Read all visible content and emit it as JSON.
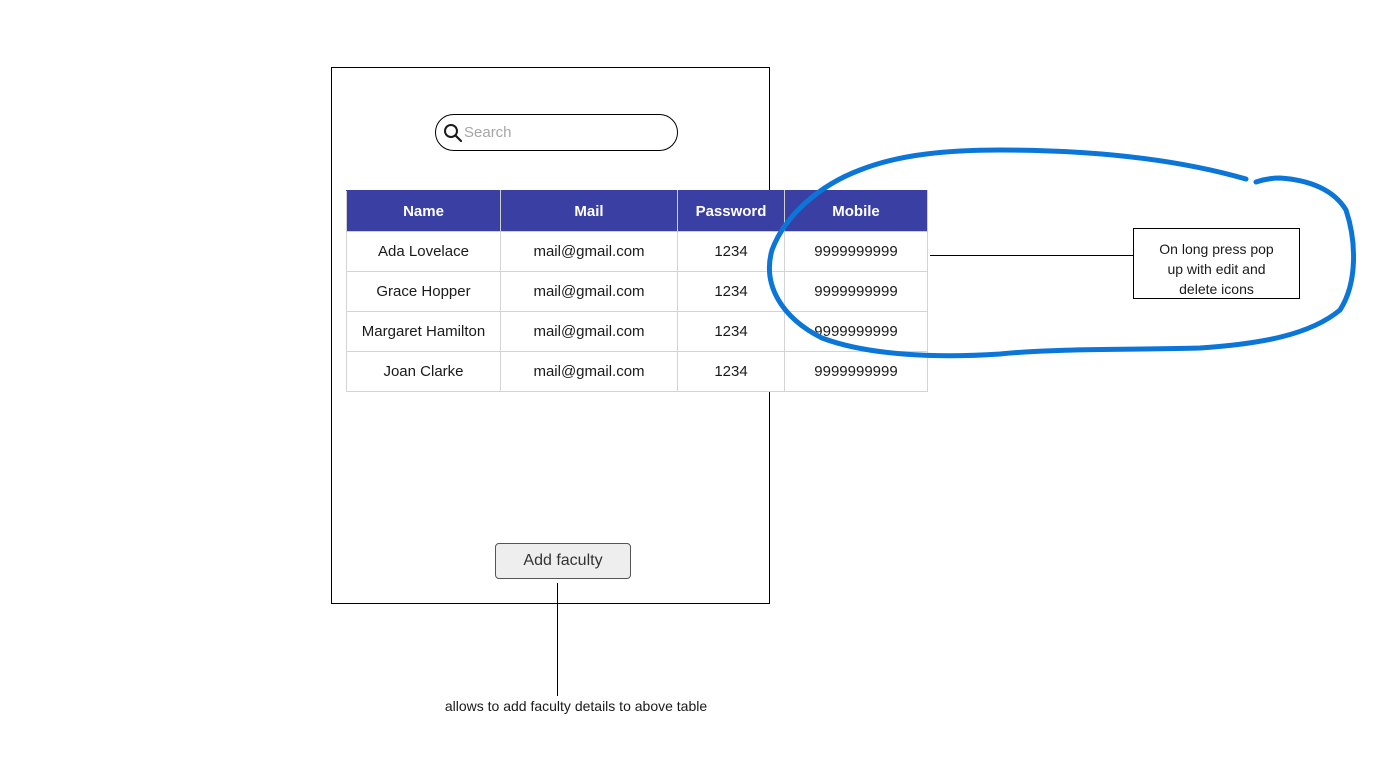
{
  "search": {
    "placeholder": "Search",
    "icon": "search-icon"
  },
  "table": {
    "headers": [
      "Name",
      "Mail",
      "Password",
      "Mobile"
    ],
    "header_color": "#3a3fa4",
    "rows": [
      [
        "Ada Lovelace",
        "mail@gmail.com",
        "1234",
        "9999999999"
      ],
      [
        "Grace Hopper",
        "mail@gmail.com",
        "1234",
        "9999999999"
      ],
      [
        "Margaret Hamilton",
        "mail@gmail.com",
        "1234",
        "9999999999"
      ],
      [
        "Joan Clarke",
        "mail@gmail.com",
        "1234",
        "9999999999"
      ]
    ]
  },
  "add_button": {
    "label": "Add faculty"
  },
  "annotations": {
    "mobile_note": [
      "On long press pop",
      "up with edit and",
      "delete icons"
    ],
    "button_note": "allows to add faculty details to above table",
    "highlight_color": "#0b76d8"
  }
}
